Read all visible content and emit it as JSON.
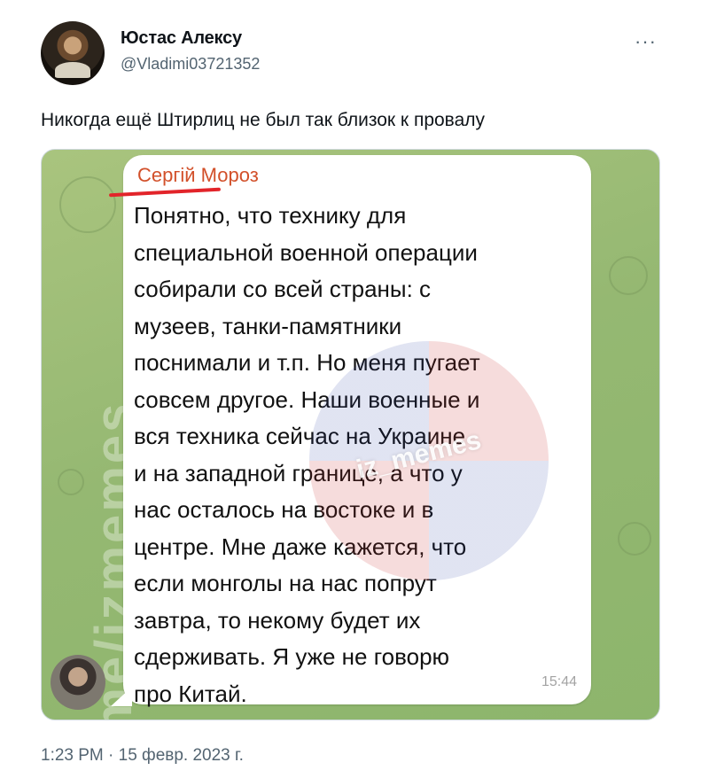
{
  "tweet": {
    "author_name": "Юстас Алексу",
    "author_handle": "@Vladimi03721352",
    "more_icon": "more-horizontal-icon",
    "text": "Никогда ещё Штирлиц не был так близок к провалу",
    "timestamp": "1:23 PM · 15 февр. 2023 г."
  },
  "media": {
    "side_watermark": "t.me/izmemes",
    "center_watermark": "iz_memes",
    "message": {
      "sender_name": "Сергій Мороз",
      "lines": [
        "Понятно, что технику для",
        "специальной военной операции",
        "собирали со всей страны: с",
        "музеев, танки-памятники",
        "поснимали и т.п. Но меня пугает",
        "совсем другое. Наши военные и",
        "вся техника сейчас на Украине",
        "и на западной границе, а что у",
        "нас осталось на востоке и в",
        "центре. Мне даже кажется, что",
        "если монголы на нас попрут",
        "завтра, то некому будет их",
        "сдерживать. Я уже не говорю",
        "про Китай."
      ],
      "time": "15:44"
    }
  },
  "colors": {
    "sender_name": "#d2502a",
    "underline": "#e2242a",
    "handle": "#536471"
  }
}
